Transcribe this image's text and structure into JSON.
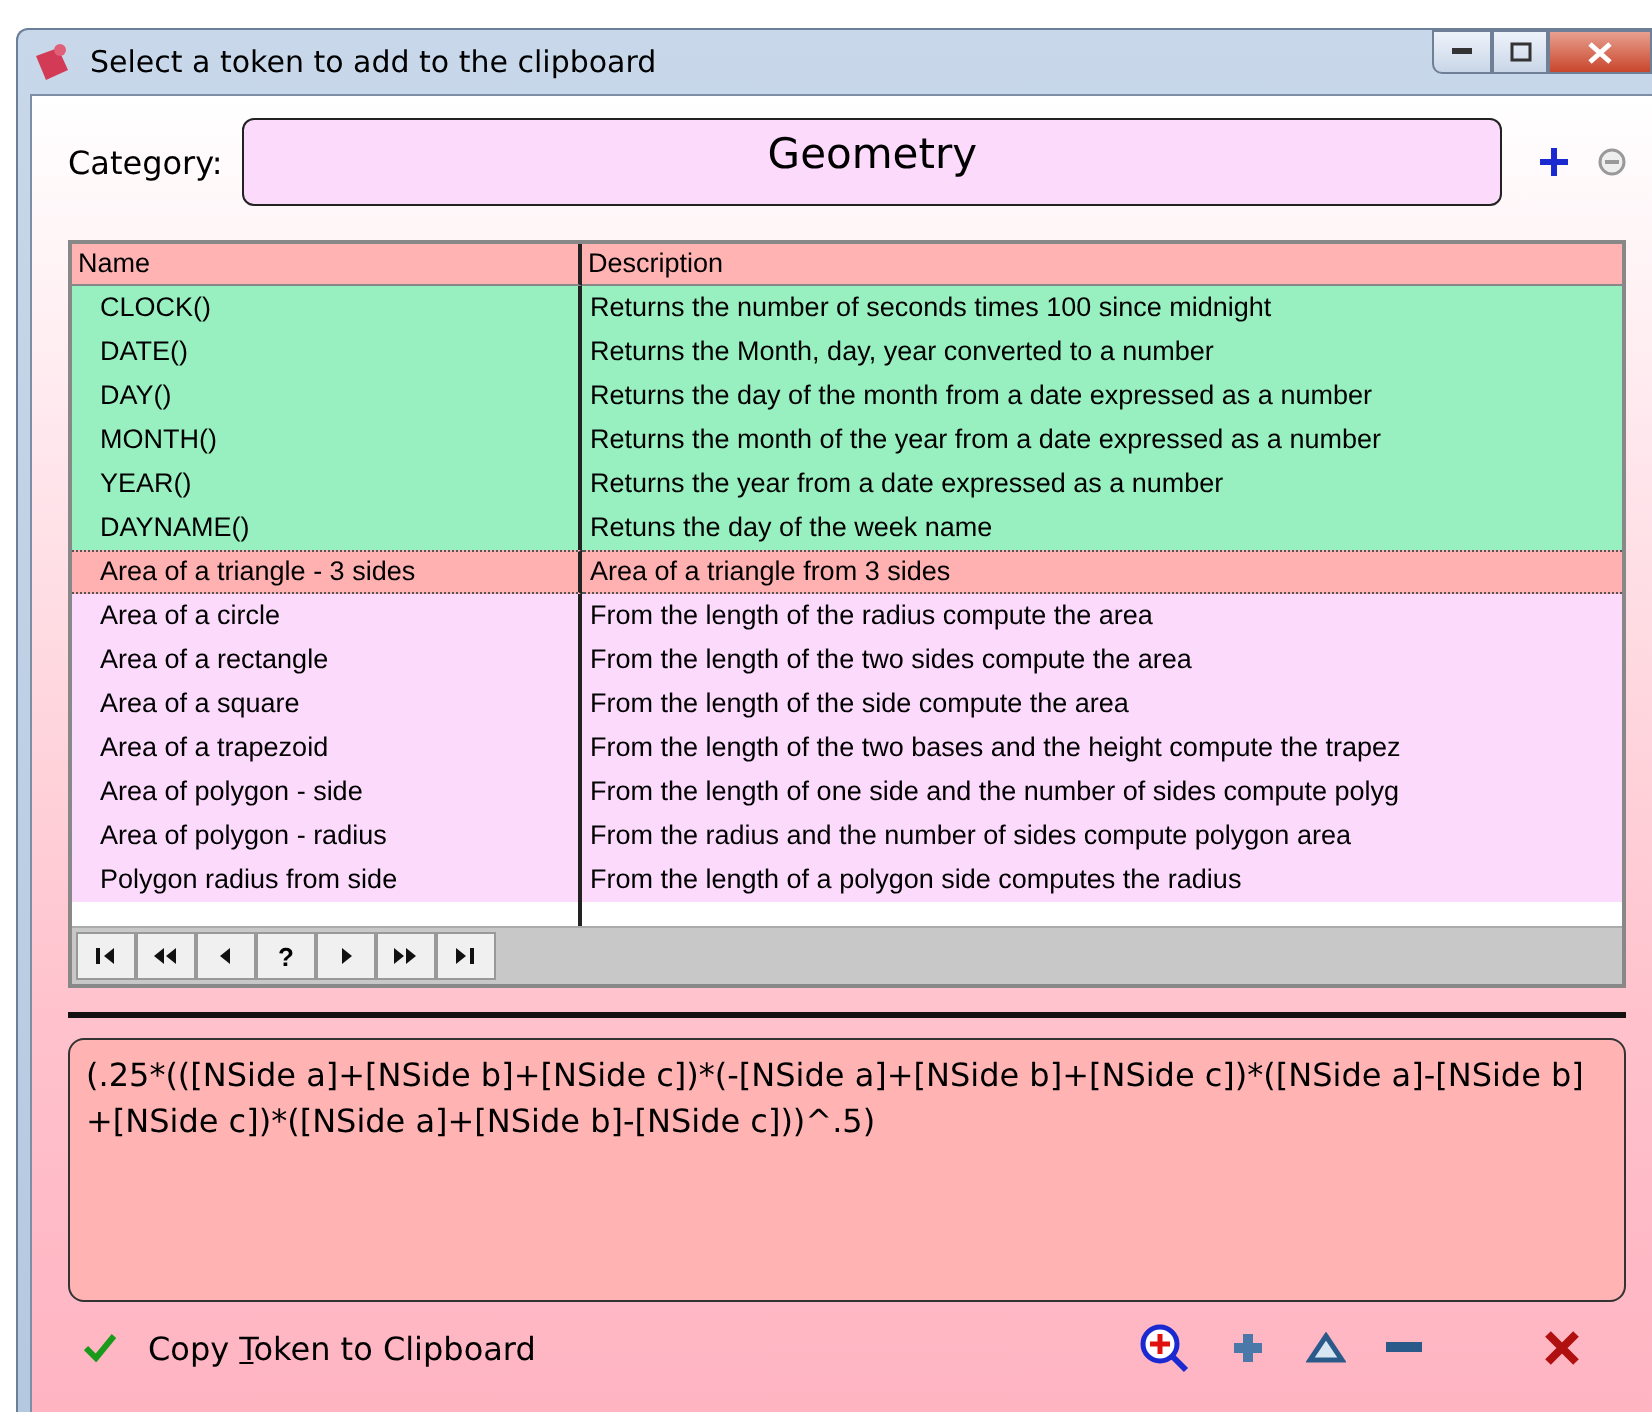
{
  "window": {
    "title": "Select a token to add to the clipboard"
  },
  "category": {
    "label": "Category:",
    "value": "Geometry"
  },
  "table": {
    "columns": [
      "Name",
      "Description"
    ],
    "rows": [
      {
        "name": "CLOCK()",
        "description": "Returns the number of seconds times 100 since midnight",
        "color": "#98f0c0",
        "selected": false
      },
      {
        "name": "DATE()",
        "description": "Returns the Month, day, year converted to a number",
        "color": "#98f0c0",
        "selected": false
      },
      {
        "name": "DAY()",
        "description": "Returns the day of the month from a date expressed as a number",
        "color": "#98f0c0",
        "selected": false
      },
      {
        "name": "MONTH()",
        "description": "Returns the month of the year from a date expressed as a number",
        "color": "#98f0c0",
        "selected": false
      },
      {
        "name": "YEAR()",
        "description": "Returns the year from a date expressed as a number",
        "color": "#98f0c0",
        "selected": false
      },
      {
        "name": "DAYNAME()",
        "description": "Retuns the day of the week name",
        "color": "#98f0c0",
        "selected": false
      },
      {
        "name": "Area of a triangle - 3 sides",
        "description": "Area of a triangle from 3 sides",
        "color": "#ffb0b0",
        "selected": true
      },
      {
        "name": "Area of a circle",
        "description": "From the length of the radius compute the area",
        "color": "#fcdafc",
        "selected": false
      },
      {
        "name": "Area of a rectangle",
        "description": "From the length of the two sides compute the area",
        "color": "#fcdafc",
        "selected": false
      },
      {
        "name": "Area of a square",
        "description": "From the length of the side compute the area",
        "color": "#fcdafc",
        "selected": false
      },
      {
        "name": "Area of a trapezoid",
        "description": "From the length of the two bases and the height compute the trapez",
        "color": "#fcdafc",
        "selected": false
      },
      {
        "name": "Area of polygon - side",
        "description": "From the length of one side and the number of sides compute polyg",
        "color": "#fcdafc",
        "selected": false
      },
      {
        "name": "Area of polygon - radius",
        "description": "From the radius and the number of sides compute polygon area",
        "color": "#fcdafc",
        "selected": false
      },
      {
        "name": "Polygon radius from side",
        "description": "From the length of a polygon side computes the radius",
        "color": "#fcdafc",
        "selected": false
      }
    ]
  },
  "navigator": [
    {
      "kind": "first"
    },
    {
      "kind": "prior-page"
    },
    {
      "kind": "prior"
    },
    {
      "kind": "help",
      "label": "?"
    },
    {
      "kind": "next"
    },
    {
      "kind": "next-page"
    },
    {
      "kind": "last"
    }
  ],
  "formula": "(.25*(([NSide a]+[NSide b]+[NSide c])*(-[NSide a]+[NSide b]+[NSide c])*([NSide a]-[NSide b]+[NSide c])*([NSide a]+[NSide b]-[NSide c]))^.5)",
  "copy_button": {
    "label_before_key": "Copy ",
    "access_key": "T",
    "label_after_key": "oken to Clipboard"
  }
}
